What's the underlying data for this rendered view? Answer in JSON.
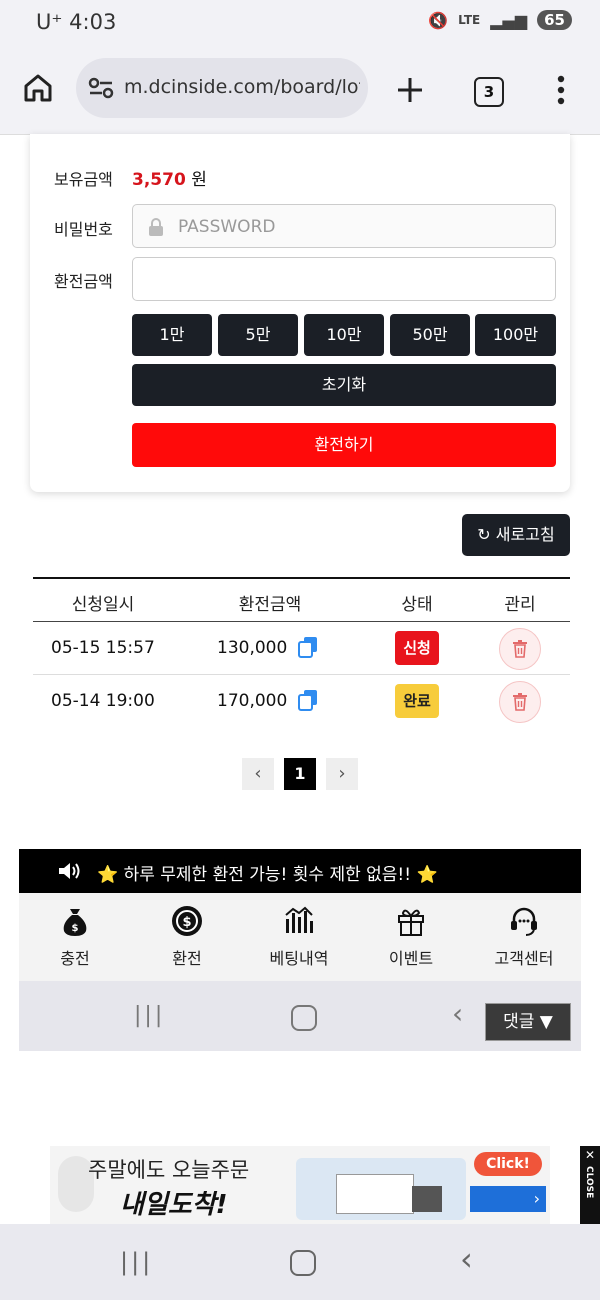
{
  "status_bar": {
    "carrier": "U⁺",
    "time": "4:03",
    "network": "LTE",
    "battery": "65"
  },
  "browser": {
    "url": "m.dcinside.com/board/lot",
    "tab_count": "3"
  },
  "form": {
    "balance_label": "보유금액",
    "balance_value": "3,570",
    "balance_unit": "원",
    "password_label": "비밀번호",
    "password_placeholder": "PASSWORD",
    "amount_label": "환전금액",
    "amount_buttons": [
      "1만",
      "5만",
      "10만",
      "50만",
      "100만"
    ],
    "reset_button": "초기화",
    "exchange_button": "환전하기"
  },
  "refresh_button": "새로고침",
  "table": {
    "headers": [
      "신청일시",
      "환전금액",
      "상태",
      "관리"
    ],
    "rows": [
      {
        "date": "05-15 15:57",
        "amount": "130,000",
        "status": "신청",
        "status_color": "#e8141c"
      },
      {
        "date": "05-14 19:00",
        "amount": "170,000",
        "status": "완료",
        "status_color": "#f7cc3b"
      }
    ]
  },
  "pagination": {
    "current": "1"
  },
  "notice": "⭐ 하루 무제한 환전 가능! 횟수 제한 없음!! ⭐",
  "bottom_nav": [
    "충전",
    "환전",
    "베팅내역",
    "이벤트",
    "고객센터"
  ],
  "comment_button": "댓글 ▼",
  "ad": {
    "line1": "주말에도 오늘주문",
    "line2": "내일도착!",
    "click": "Click!",
    "close": "CLOSE"
  },
  "colors": {
    "accent_red": "#ff0a0a",
    "dark_button": "#1b1f26"
  }
}
